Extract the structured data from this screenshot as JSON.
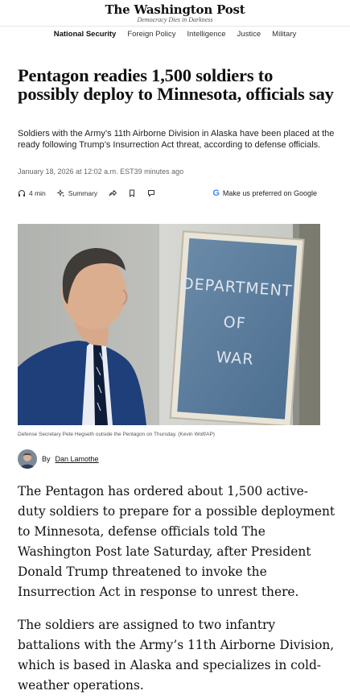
{
  "masthead": {
    "logo": "The Washington Post",
    "tagline": "Democracy Dies in Darkness"
  },
  "nav": {
    "items": [
      "National Security",
      "Foreign Policy",
      "Intelligence",
      "Justice",
      "Military"
    ],
    "active": "National Security"
  },
  "article": {
    "headline": "Pentagon readies 1,500 soldiers to possibly deploy to Minnesota, officials say",
    "dek": "Soldiers with the Army’s 11th Airborne Division in Alaska have been placed at the ready following Trump’s Insurrection Act threat, according to defense officials.",
    "timestamp": "January 18, 2026 at 12:02 a.m. EST39 minutes ago"
  },
  "actions": {
    "listen": "4 min",
    "summary": "Summary",
    "google": "Make us preferred on Google"
  },
  "photo": {
    "sign_text": "DEPARTMENT OF WAR",
    "caption": "Defense Secretary Pete Hegseth outside the Pentagon on Thursday. (Kevin Wolf/AP)"
  },
  "byline": {
    "prefix": "By",
    "author": "Dan Lamothe"
  },
  "body": {
    "p1": "The Pentagon has ordered about 1,500 active-duty soldiers to prepare for a possible deployment to Minnesota, defense officials told The Washington Post late Saturday, after President Donald Trump threatened to invoke the Insurrection Act in response to unrest there.",
    "p2": "The soldiers are assigned to two infantry battalions with the Army’s 11th Airborne Division, which is based in Alaska and specializes in cold-weather operations."
  }
}
